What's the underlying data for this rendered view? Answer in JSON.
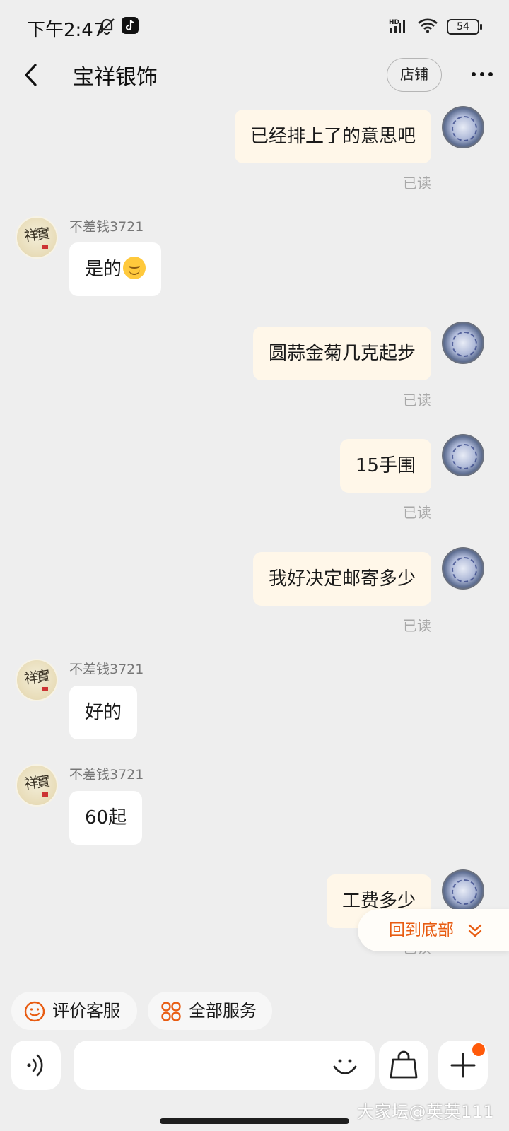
{
  "status_bar": {
    "time": "下午2:47",
    "network": "HD",
    "battery": "54"
  },
  "header": {
    "title": "宝祥银饰",
    "shop_button": "店铺"
  },
  "messages": [
    {
      "side": "out",
      "text": "已经排上了的意思吧",
      "read": "已读"
    },
    {
      "side": "in",
      "sender": "不差钱3721",
      "text": "是的"
    },
    {
      "side": "out",
      "text": "圆蒜金菊几克起步",
      "read": "已读"
    },
    {
      "side": "out",
      "text": "15手围",
      "read": "已读"
    },
    {
      "side": "out",
      "text": "我好决定邮寄多少",
      "read": "已读"
    },
    {
      "side": "in",
      "sender": "不差钱3721",
      "text": "好的"
    },
    {
      "side": "in",
      "sender": "不差钱3721",
      "text": "60起"
    },
    {
      "side": "out",
      "text": "工费多少",
      "read": "已读"
    }
  ],
  "scroll_to_bottom": "回到底部",
  "quick_actions": [
    {
      "label": "评价客服",
      "icon": "smile-icon"
    },
    {
      "label": "全部服务",
      "icon": "grid-icon"
    }
  ],
  "input": {
    "placeholder": ""
  },
  "watermark": "大家坛@英英111",
  "colors": {
    "accent": "#e85c12",
    "outgoing_bubble": "#fff7e9",
    "incoming_bubble": "#ffffff",
    "background": "#eeeeee",
    "notification_dot": "#ff5a0a"
  }
}
